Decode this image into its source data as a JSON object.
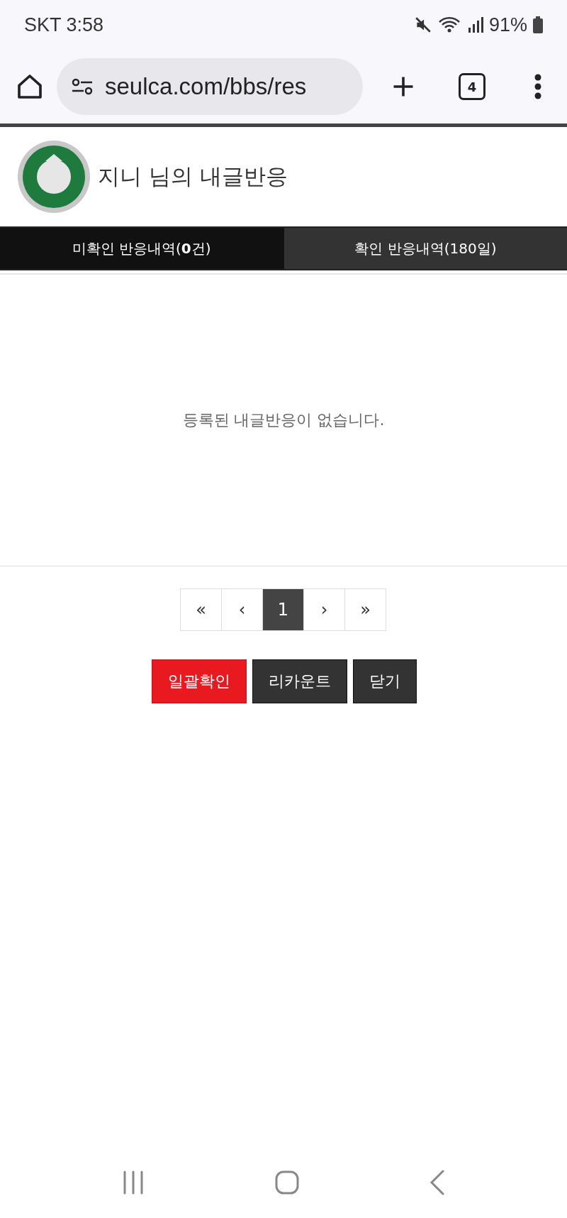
{
  "status_bar": {
    "carrier_time": "SKT 3:58",
    "battery": "91%"
  },
  "browser": {
    "url": "seulca.com/bbs/res",
    "tab_count": "4"
  },
  "header": {
    "title": "지니 님의 내글반응"
  },
  "tabs": [
    {
      "label": "미확인 반응내역(**0**건)",
      "selected": true
    },
    {
      "label": "확인 반응내역(180일)",
      "selected": false
    }
  ],
  "empty_message": "등록된 내글반응이 없습니다.",
  "pagination": [
    {
      "label": "«",
      "selected": false
    },
    {
      "label": "‹",
      "selected": false
    },
    {
      "label": "1",
      "selected": true
    },
    {
      "label": "›",
      "selected": false
    },
    {
      "label": "»",
      "selected": false
    }
  ],
  "buttons": [
    {
      "label": "일괄확인",
      "kind": "primary"
    },
    {
      "label": "리카운트",
      "kind": "secondary"
    },
    {
      "label": "닫기",
      "kind": "secondary"
    }
  ]
}
